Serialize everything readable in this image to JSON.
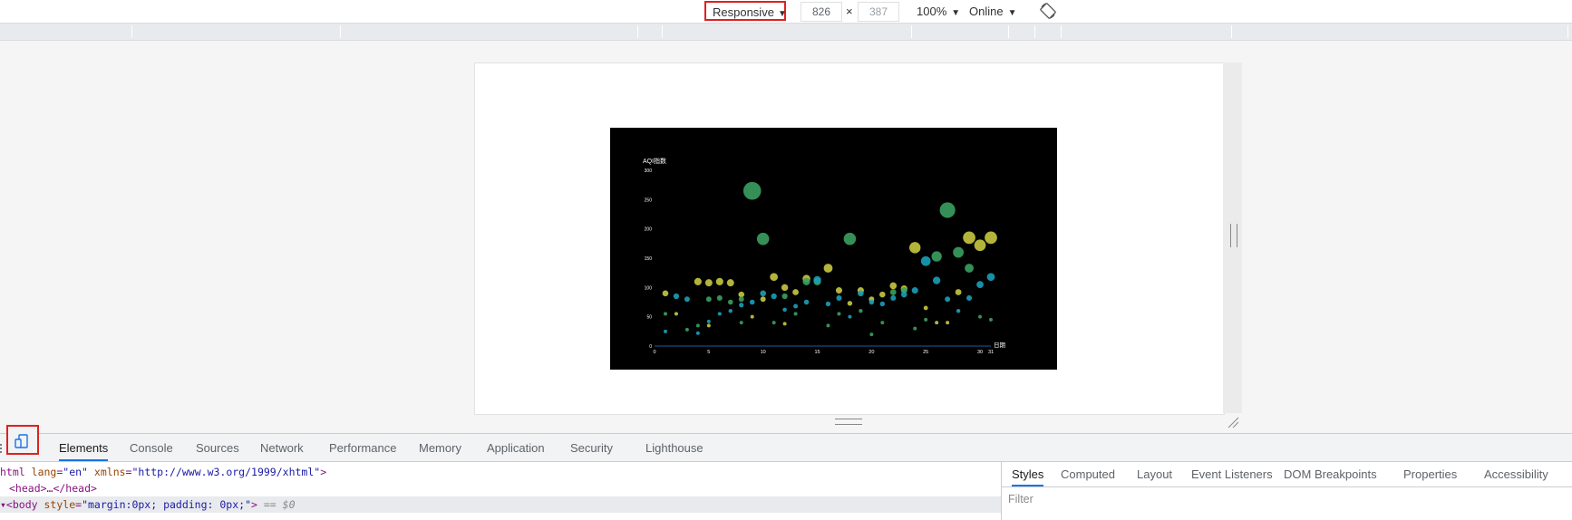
{
  "device_toolbar": {
    "device_select": "Responsive",
    "width_value": "826",
    "times": "×",
    "height_value": "387",
    "zoom": "100%",
    "network": "Online",
    "caret": "▼"
  },
  "chart_data": {
    "type": "scatter",
    "title": "AQI指数",
    "xlabel": "日期",
    "ylabel": "AQI指数",
    "xlim": [
      0,
      31
    ],
    "ylim": [
      0,
      300
    ],
    "x_ticks": [
      "0",
      "5",
      "10",
      "15",
      "20",
      "25",
      "30",
      "31"
    ],
    "y_ticks": [
      "0",
      "50",
      "100",
      "150",
      "200",
      "250",
      "300"
    ],
    "background": "#000000",
    "axis_color": "#1e5aa8",
    "series": [
      {
        "color": "#c8c840",
        "points": [
          [
            1,
            90
          ],
          [
            2,
            55
          ],
          [
            4,
            110
          ],
          [
            5,
            108
          ],
          [
            6,
            110
          ],
          [
            7,
            108
          ],
          [
            8,
            88
          ],
          [
            9,
            50
          ],
          [
            10,
            80
          ],
          [
            11,
            118
          ],
          [
            12,
            100
          ],
          [
            13,
            92
          ],
          [
            14,
            115
          ],
          [
            16,
            133
          ],
          [
            17,
            95
          ],
          [
            18,
            73
          ],
          [
            19,
            95
          ],
          [
            20,
            80
          ],
          [
            21,
            88
          ],
          [
            22,
            103
          ],
          [
            23,
            98
          ],
          [
            24,
            168
          ],
          [
            25,
            65
          ],
          [
            26,
            40
          ],
          [
            27,
            40
          ],
          [
            28,
            92
          ],
          [
            29,
            185
          ],
          [
            30,
            172
          ],
          [
            31,
            185
          ],
          [
            5,
            35
          ],
          [
            12,
            38
          ]
        ]
      },
      {
        "color": "#3aa060",
        "points": [
          [
            1,
            55
          ],
          [
            3,
            28
          ],
          [
            4,
            35
          ],
          [
            5,
            80
          ],
          [
            6,
            82
          ],
          [
            7,
            75
          ],
          [
            8,
            80
          ],
          [
            9,
            265
          ],
          [
            10,
            183
          ],
          [
            11,
            40
          ],
          [
            12,
            85
          ],
          [
            13,
            55
          ],
          [
            14,
            110
          ],
          [
            15,
            110
          ],
          [
            16,
            35
          ],
          [
            17,
            55
          ],
          [
            18,
            183
          ],
          [
            19,
            60
          ],
          [
            20,
            20
          ],
          [
            21,
            40
          ],
          [
            22,
            92
          ],
          [
            23,
            95
          ],
          [
            24,
            30
          ],
          [
            25,
            45
          ],
          [
            26,
            153
          ],
          [
            27,
            232
          ],
          [
            28,
            160
          ],
          [
            29,
            133
          ],
          [
            30,
            50
          ],
          [
            31,
            45
          ],
          [
            8,
            40
          ]
        ]
      },
      {
        "color": "#1aa0b8",
        "points": [
          [
            1,
            25
          ],
          [
            2,
            85
          ],
          [
            3,
            80
          ],
          [
            4,
            22
          ],
          [
            5,
            42
          ],
          [
            6,
            55
          ],
          [
            7,
            60
          ],
          [
            8,
            70
          ],
          [
            9,
            75
          ],
          [
            10,
            90
          ],
          [
            11,
            85
          ],
          [
            12,
            62
          ],
          [
            13,
            68
          ],
          [
            14,
            75
          ],
          [
            15,
            113
          ],
          [
            16,
            72
          ],
          [
            17,
            82
          ],
          [
            18,
            50
          ],
          [
            19,
            90
          ],
          [
            20,
            75
          ],
          [
            21,
            72
          ],
          [
            22,
            82
          ],
          [
            23,
            88
          ],
          [
            24,
            95
          ],
          [
            25,
            145
          ],
          [
            26,
            112
          ],
          [
            27,
            80
          ],
          [
            28,
            60
          ],
          [
            29,
            82
          ],
          [
            30,
            105
          ],
          [
            31,
            118
          ]
        ]
      }
    ]
  },
  "devtools": {
    "tabs": [
      "Elements",
      "Console",
      "Sources",
      "Network",
      "Performance",
      "Memory",
      "Application",
      "Security",
      "Lighthouse"
    ],
    "active_tab": "Elements",
    "code": {
      "line1": {
        "tag_open": "html",
        "attr1": "lang",
        "val1": "\"en\"",
        "attr2": "xmlns",
        "val2": "\"http://www.w3.org/1999/xhtml\""
      },
      "line2": {
        "text": "<head>…</head>"
      },
      "line3": {
        "tag": "body",
        "attr": "style",
        "val": "\"margin:0px; padding: 0px;\"",
        "dollar": "== $0"
      }
    },
    "styles_tabs": [
      "Styles",
      "Computed",
      "Layout",
      "Event Listeners",
      "DOM Breakpoints",
      "Properties",
      "Accessibility"
    ],
    "filter_placeholder": "Filter"
  }
}
